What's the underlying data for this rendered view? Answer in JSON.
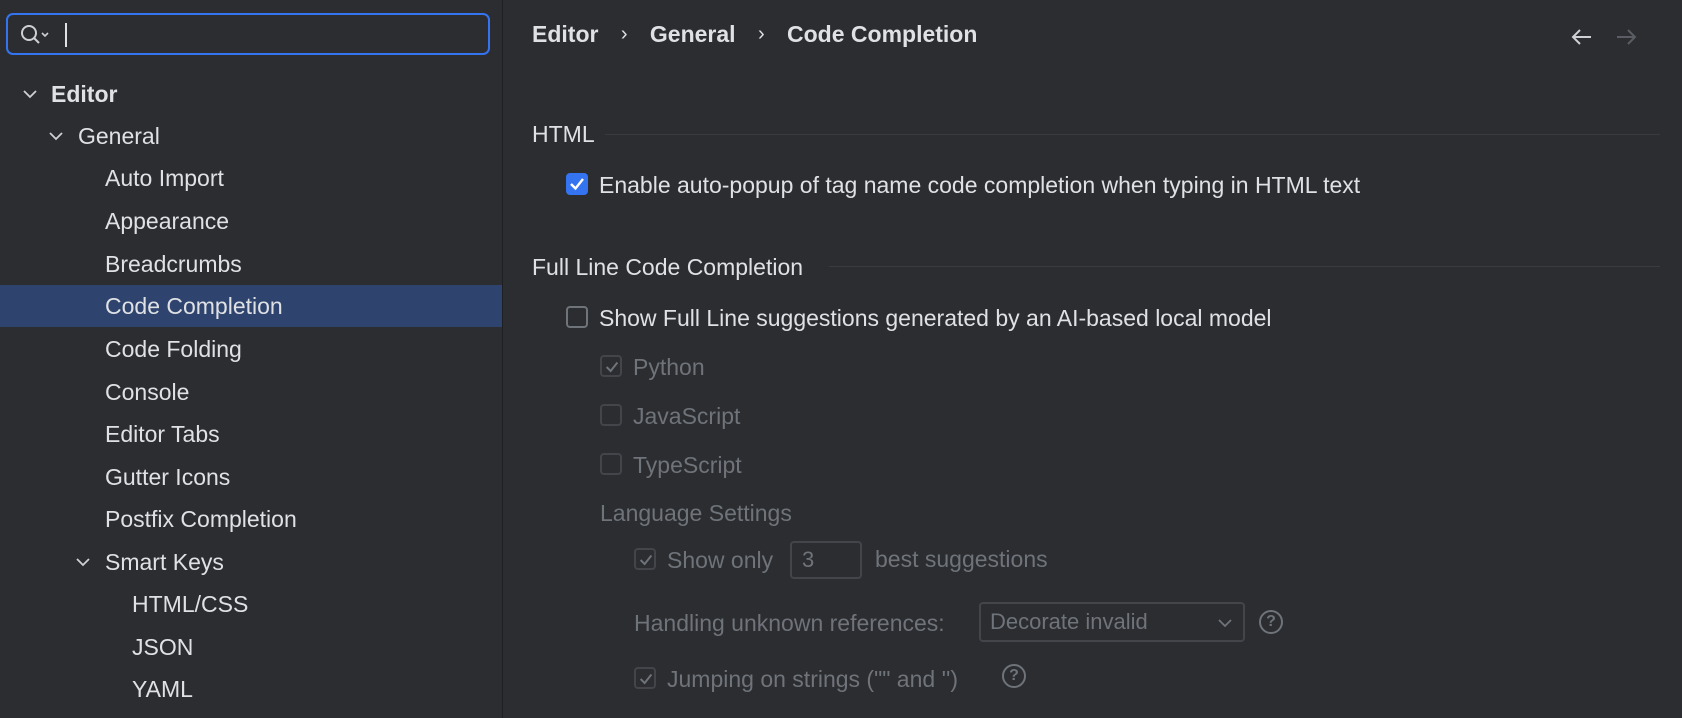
{
  "search": {
    "placeholder": "",
    "value": ""
  },
  "sidebar": {
    "items": [
      {
        "label": "Editor"
      },
      {
        "label": "General"
      },
      {
        "label": "Auto Import"
      },
      {
        "label": "Appearance"
      },
      {
        "label": "Breadcrumbs"
      },
      {
        "label": "Code Completion"
      },
      {
        "label": "Code Folding"
      },
      {
        "label": "Console"
      },
      {
        "label": "Editor Tabs"
      },
      {
        "label": "Gutter Icons"
      },
      {
        "label": "Postfix Completion"
      },
      {
        "label": "Smart Keys"
      },
      {
        "label": "HTML/CSS"
      },
      {
        "label": "JSON"
      },
      {
        "label": "YAML"
      }
    ]
  },
  "breadcrumb": {
    "level1": "Editor",
    "level2": "General",
    "level3": "Code Completion",
    "separator": "›"
  },
  "html_section": {
    "title": "HTML",
    "autopopup_label": "Enable auto-popup of tag name code completion when typing in HTML text"
  },
  "fullline_section": {
    "title": "Full Line Code Completion",
    "show_label": "Show Full Line suggestions generated by an AI-based local model",
    "python_label": "Python",
    "javascript_label": "JavaScript",
    "typescript_label": "TypeScript",
    "language_settings_label": "Language Settings",
    "show_only_label": "Show only",
    "show_only_value": "3",
    "best_suggestions_label": "best suggestions",
    "handling_label": "Handling unknown references:",
    "handling_value": "Decorate invalid",
    "jumping_label": "Jumping on strings (\"\" and '')",
    "help_glyph": "?"
  },
  "colors": {
    "accent": "#3574F0",
    "selection": "#2E436E",
    "background": "#2B2D30"
  }
}
